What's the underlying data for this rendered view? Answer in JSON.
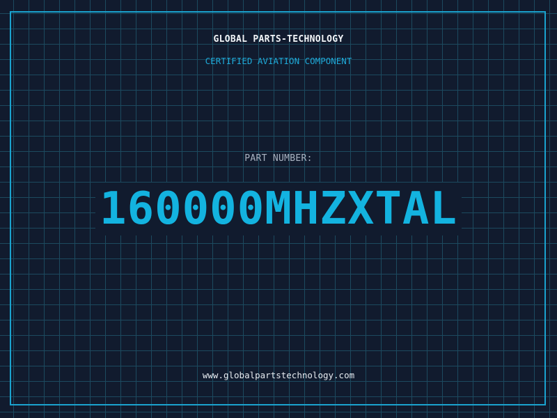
{
  "header": {
    "company": "GLOBAL PARTS-TECHNOLOGY",
    "subtitle": "CERTIFIED AVIATION COMPONENT"
  },
  "part": {
    "label": "PART NUMBER:",
    "number": "160000MHZXTAL"
  },
  "footer": {
    "url": "www.globalpartstechnology.com"
  },
  "colors": {
    "background": "#111b2e",
    "grid": "#1c4a5f",
    "accent": "#13b3e0",
    "frame": "#1aa3cf",
    "text": "#f2f5f8"
  }
}
